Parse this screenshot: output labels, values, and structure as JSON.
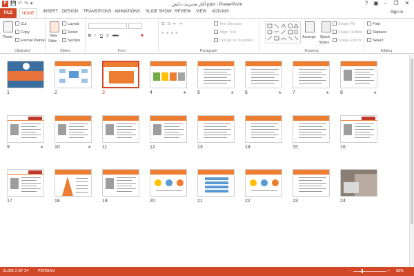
{
  "window": {
    "title": "آغاز مدیریت دانش.pptx - PowerPoint",
    "app_icon": "P",
    "minimize": "–",
    "restore": "❐",
    "close": "✕",
    "help": "?",
    "options": "▣"
  },
  "quick_access": {
    "save": "💾",
    "undo": "↶",
    "redo": "↷",
    "customize": "▾"
  },
  "tabs": [
    "FILE",
    "HOME",
    "INSERT",
    "DESIGN",
    "TRANSITIONS",
    "ANIMATIONS",
    "SLIDE SHOW",
    "REVIEW",
    "VIEW",
    "ADD-INS"
  ],
  "active_tab": "HOME",
  "sign_in": "Sign in",
  "ribbon": {
    "clipboard": {
      "paste": "Paste",
      "cut": "Cut",
      "copy": "Copy",
      "format_painter": "Format Painter",
      "label": "Clipboard"
    },
    "slides": {
      "new_slide": "New",
      "new_slide_2": "Slide",
      "layout": "Layout",
      "reset": "Reset",
      "section": "Section",
      "label": "Slides"
    },
    "font": {
      "label": "Font",
      "bold": "B",
      "italic": "I",
      "underline": "U",
      "shadow": "S",
      "strike": "abc",
      "font_color": "A"
    },
    "paragraph": {
      "text_direction": "Text Direction",
      "align_text": "Align Text",
      "convert_smartart": "Convert to SmartArt",
      "label": "Paragraph"
    },
    "drawing": {
      "arrange": "Arrange",
      "quick_styles": "Quick",
      "quick_styles_2": "Styles",
      "shape_fill": "Shape Fill",
      "shape_outline": "Shape Outline",
      "shape_effects": "Shape Effects",
      "label": "Drawing"
    },
    "editing": {
      "find": "Find",
      "replace": "Replace",
      "select": "Select",
      "label": "Editing"
    }
  },
  "slides": [
    {
      "num": "1",
      "kind": "cover",
      "star": ""
    },
    {
      "num": "2",
      "kind": "diagram",
      "star": ""
    },
    {
      "num": "3",
      "kind": "orangebox",
      "star": "",
      "selected": true
    },
    {
      "num": "4",
      "kind": "arrows",
      "star": "★"
    },
    {
      "num": "5",
      "kind": "text",
      "star": "★"
    },
    {
      "num": "6",
      "kind": "text",
      "star": "★"
    },
    {
      "num": "7",
      "kind": "text",
      "star": "★"
    },
    {
      "num": "8",
      "kind": "textpic",
      "star": "★"
    },
    {
      "num": "9",
      "kind": "light",
      "star": "★"
    },
    {
      "num": "10",
      "kind": "textpic",
      "star": "★"
    },
    {
      "num": "11",
      "kind": "textpic",
      "star": ""
    },
    {
      "num": "12",
      "kind": "textpic",
      "star": ""
    },
    {
      "num": "13",
      "kind": "text",
      "star": ""
    },
    {
      "num": "14",
      "kind": "text",
      "star": ""
    },
    {
      "num": "15",
      "kind": "text",
      "star": ""
    },
    {
      "num": "16",
      "kind": "light",
      "star": ""
    },
    {
      "num": "17",
      "kind": "light",
      "star": ""
    },
    {
      "num": "18",
      "kind": "pyramid",
      "star": ""
    },
    {
      "num": "19",
      "kind": "textpic",
      "star": ""
    },
    {
      "num": "20",
      "kind": "circles",
      "star": ""
    },
    {
      "num": "21",
      "kind": "bars",
      "star": ""
    },
    {
      "num": "22",
      "kind": "circles",
      "star": ""
    },
    {
      "num": "23",
      "kind": "text",
      "star": ""
    },
    {
      "num": "24",
      "kind": "photo",
      "star": ""
    }
  ],
  "status_bar": {
    "slide_info": "SLIDE 3 OF 24",
    "language": "PERSIAN",
    "zoom": "58%",
    "zoom_minus": "–",
    "zoom_plus": "+"
  },
  "colors": {
    "accent": "#d24726",
    "slide_orange": "#ed7d31"
  }
}
